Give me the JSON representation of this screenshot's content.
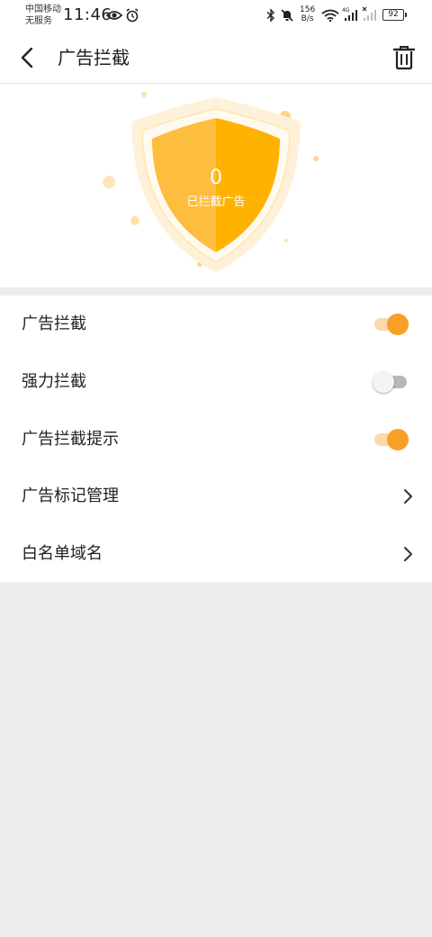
{
  "status_bar": {
    "carrier_line1": "中国移动",
    "carrier_line2": "无服务",
    "time": "11:46",
    "net_speed_value": "156",
    "net_speed_unit": "B/s",
    "network_type": "4G",
    "battery_level": "92",
    "icons": [
      "eye-icon",
      "alarm-icon",
      "bluetooth-icon",
      "mute-icon",
      "wifi-icon",
      "signal-icon",
      "signal-icon",
      "battery-icon"
    ]
  },
  "header": {
    "title": "广告拦截",
    "back_icon": "chevron-left-icon",
    "delete_icon": "trash-icon"
  },
  "hero": {
    "blocked_count": "0",
    "blocked_label": "已拦截广告",
    "colors": {
      "shield_left": "#fdbd3e",
      "shield_right": "#ffb300",
      "halo": "#fff1d9"
    }
  },
  "settings": {
    "items": [
      {
        "label": "广告拦截",
        "type": "toggle",
        "enabled": true
      },
      {
        "label": "强力拦截",
        "type": "toggle",
        "enabled": false
      },
      {
        "label": "广告拦截提示",
        "type": "toggle",
        "enabled": true
      },
      {
        "label": "广告标记管理",
        "type": "link"
      },
      {
        "label": "白名单域名",
        "type": "link"
      }
    ]
  },
  "colors": {
    "accent": "#f7a028",
    "accent_track": "#fbd9ac",
    "background": "#ededed"
  }
}
